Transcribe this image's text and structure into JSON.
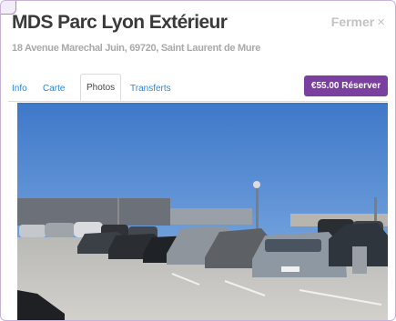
{
  "modal": {
    "title": "MDS Parc Lyon Extérieur",
    "close_label": "Fermer",
    "close_glyph": "×",
    "address": "18 Avenue Marechal Juin, 69720, Saint Laurent de Mure"
  },
  "tabs": [
    {
      "label": "Info",
      "active": false
    },
    {
      "label": "Carte",
      "active": false
    },
    {
      "label": "Photos",
      "active": true
    },
    {
      "label": "Transferts",
      "active": false
    }
  ],
  "reserve_button": {
    "label": "€55.00 Réserver",
    "color": "#7a3f9f"
  },
  "colors": {
    "link": "#2a87d8",
    "sky": "#4f87d2",
    "frame": "#c7b2dc"
  }
}
